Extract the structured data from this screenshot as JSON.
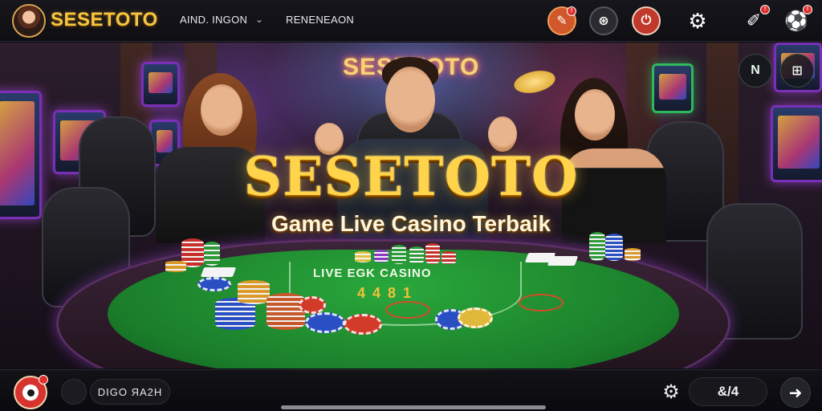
{
  "header": {
    "brand": "SESETOTO",
    "nav_primary": "AIND. INGON",
    "nav_primary_caret": "⌄",
    "nav_secondary": "RENENEAON",
    "icons": [
      {
        "name": "pen-icon",
        "glyph": "✎",
        "bg": "#d0582a",
        "badge": "!"
      },
      {
        "name": "chat-icon",
        "glyph": "⊛",
        "bg": "#2a2a30",
        "badge": ""
      },
      {
        "name": "power-icon",
        "glyph": "⏻",
        "bg": "#c0392b",
        "badge": ""
      },
      {
        "name": "gear-icon",
        "glyph": "⚙",
        "bg": "transparent",
        "badge": ""
      },
      {
        "name": "edit-icon",
        "glyph": "✐",
        "bg": "transparent",
        "badge": "!"
      },
      {
        "name": "soccer-ball-icon",
        "glyph": "⚽",
        "bg": "transparent",
        "badge": "!"
      }
    ]
  },
  "hero": {
    "neon_sign": "SESETOTO",
    "title": "SESETOTO",
    "subtitle": "Game Live Casino Terbaik",
    "felt_text": "LIVE EGK CASINO",
    "felt_numbers": "4 4 8 1",
    "side_buttons": [
      {
        "name": "nk-icon",
        "glyph": "N"
      },
      {
        "name": "grid-plus-icon",
        "glyph": "⊞"
      }
    ]
  },
  "footer": {
    "pill_text": "DIGO ЯA2H",
    "pill2_text": "&/4",
    "gear_glyph": "⚙",
    "arrow_glyph": "➜"
  },
  "colors": {
    "brand_gold": "#f5c542",
    "felt_green": "#1a7d2a",
    "accent_red": "#d7342f",
    "neon_purple": "#7a2fb8"
  }
}
